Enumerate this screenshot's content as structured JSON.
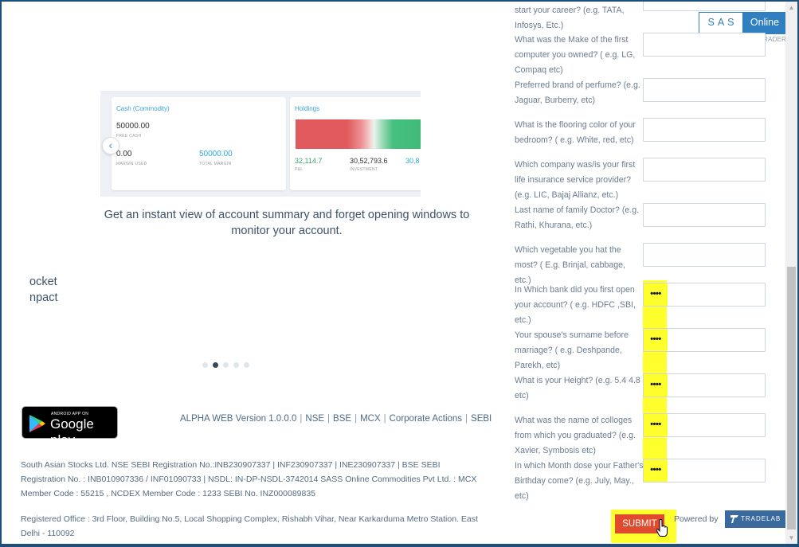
{
  "slider": {
    "screenshot": {
      "cash_title": "Cash (Commodity)",
      "cash_value": "50000.00",
      "free_cash_label": "FREE CASH",
      "margin_used_value": "0.00",
      "margin_used_label": "MARGIN USED",
      "total_margin_value": "50000.00",
      "total_margin_label": "TOTAL MARGIN",
      "holdings_title": "Holdings",
      "pnl_value": "32,114.7",
      "pnl_label": "P&L",
      "investment_value": "30,52,793.6",
      "investment_label": "INVESTMENT",
      "current_value": "30,8"
    },
    "caption": "Get an instant view of account summary and forget opening windows to monitor your account.",
    "fragment_1": "ocket",
    "fragment_2": "npact",
    "dot_count": 5,
    "active_dot": 1
  },
  "google_play": {
    "small_text": "ANDROID APP ON",
    "big_text": "Google play"
  },
  "footer": {
    "links": [
      "ALPHA WEB Version 1.0.0.0",
      "NSE",
      "BSE",
      "MCX",
      "Corporate Actions",
      "SEBI"
    ],
    "legal_1": "South Asian Stocks Ltd. NSE SEBI Registration No.:INB230907337 | INF230907337 | INE230907337 | BSE SEBI Registration No. : INB010907336 / INF01090733 | NSDL: IN-DP-NSDL-3742014 SASS Online Commodities Pvt Ltd. : MCX Member Code : 55215 , NCDEX Member Code : 1233 SEBI No. INZ000089835",
    "legal_2": "Registered Office : 3rd Floor, Building No.5, Local Shopping Complex, Rishabh Vihar, Near Karkarduma Metro Station. East Delhi - 110092"
  },
  "brand": {
    "left": "SAS",
    "right": "Online",
    "tagline": "BY TRADERS FOR TRADERS"
  },
  "questions": [
    {
      "text": "start your career? (e.g. TATA, Infosys, Etc.)",
      "value": ""
    },
    {
      "text": "What was the Make of the first computer you owned? ( e.g. LG, Compaq etc)",
      "value": ""
    },
    {
      "text": "Preferred brand of perfume? (e.g. Jaguar, Burberry, etc)",
      "value": ""
    },
    {
      "text": "What is the flooring color of your bedroom? ( e.g. White, red, etc)",
      "value": ""
    },
    {
      "text": "Which company was/is your first life insurance service provider? (e.g. LIC, Bajaj Allianz, etc.)",
      "value": ""
    },
    {
      "text": "Last name of family Doctor? (e.g. Rathi, Khurana, etc.)",
      "value": ""
    },
    {
      "text": "Which vegetable you hat the most? ( E.g. Brinjal, cabbage, etc.)",
      "value": ""
    },
    {
      "text": "In Which bank did you first open your account? ( e.g. HDFC ,SBI, etc.)",
      "value": "••••"
    },
    {
      "text": "Your spouse's surname before marriage? ( e.g. Deshpande, Parekh, etc)",
      "value": "••••"
    },
    {
      "text": "What is your Height? (e.g. 5.4 4.8 etc)",
      "value": "••••"
    },
    {
      "text": "What was the name of colloges from which you graduated? (e.g. Xavier, Symbosis etc)",
      "value": "••••"
    },
    {
      "text": "In which Month dose your Father's Birthday come? (e.g. July, May., etc)",
      "value": "••••"
    }
  ],
  "submit_label": "SUBMIT",
  "powered_by": "Powered by",
  "tradelab": "TRADELAB",
  "colors": {
    "highlight": "#ffff2e",
    "submit": "#e04a2f",
    "brand_blue": "#2f7fc1"
  }
}
